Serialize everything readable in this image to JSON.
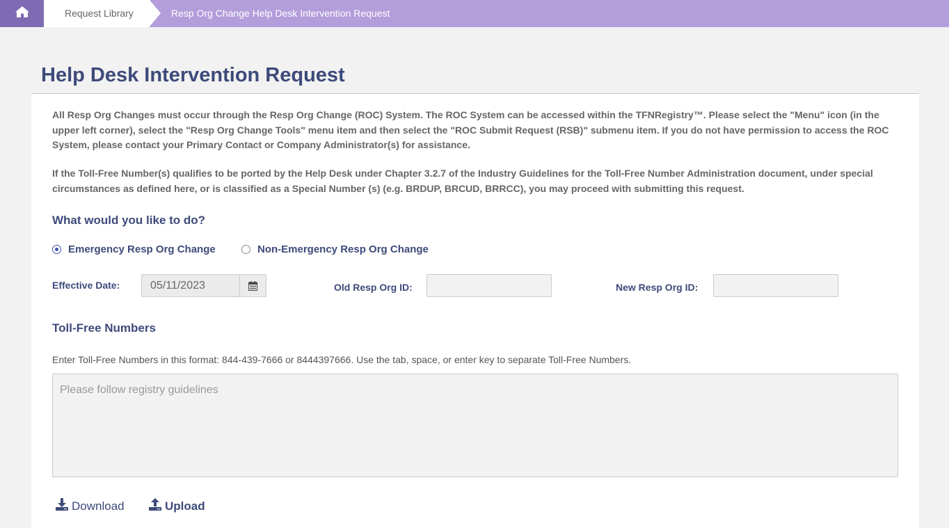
{
  "breadcrumb": {
    "home_icon": "home-icon",
    "items": [
      "Request Library",
      "Resp Org Change Help Desk Intervention Request"
    ]
  },
  "page": {
    "title": "Help Desk Intervention Request",
    "intro_1": "All Resp Org Changes must occur through the Resp Org Change (ROC) System. The ROC System can be accessed within the TFNRegistry™. Please select the \"Menu\" icon (in the upper left corner), select the \"Resp Org Change Tools\" menu item and then select the \"ROC Submit Request (RSB)\" submenu item. If you do not have permission to access the ROC System, please contact your Primary Contact or Company Administrator(s) for assistance.",
    "intro_2": "If the Toll-Free Number(s) qualifies to be ported by the Help Desk under Chapter 3.2.7 of the Industry Guidelines for the Toll-Free Number Administration document, under special circumstances as defined here, or is classified as a Special Number (s) (e.g. BRDUP, BRCUD, BRRCC), you may proceed with submitting this request."
  },
  "form": {
    "question": "What would you like to do?",
    "options": [
      {
        "label": "Emergency Resp Org Change",
        "selected": true
      },
      {
        "label": "Non-Emergency Resp Org Change",
        "selected": false
      }
    ],
    "effective_date_label": "Effective Date:",
    "effective_date_value": "05/11/2023",
    "old_resp_org_label": "Old Resp Org ID:",
    "old_resp_org_value": "",
    "new_resp_org_label": "New Resp Org ID:",
    "new_resp_org_value": ""
  },
  "tfn": {
    "title": "Toll-Free Numbers",
    "hint": "Enter Toll-Free Numbers in this format: 844-439-7666 or 8444397666. Use the tab, space, or enter key to separate Toll-Free Numbers.",
    "placeholder": "Please follow registry guidelines"
  },
  "actions": {
    "download": "Download",
    "upload": "Upload"
  },
  "colors": {
    "accent": "#3d4a7a",
    "breadcrumb_bg": "#b39ddb",
    "home_bg": "#7e6bb3"
  }
}
